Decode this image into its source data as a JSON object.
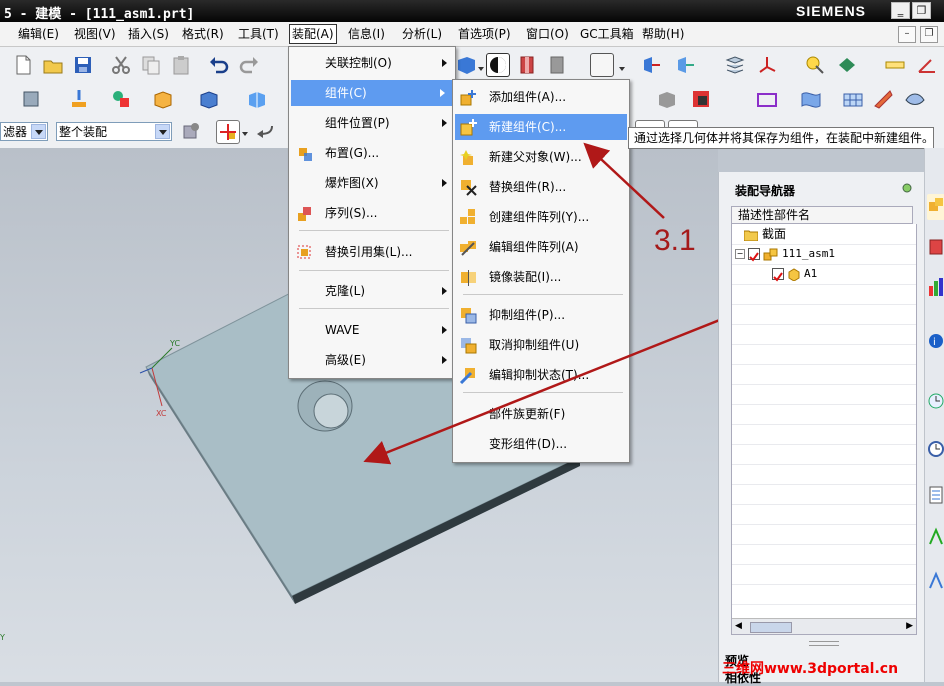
{
  "window": {
    "title": "5 - 建模 - [111_asm1.prt]",
    "brand": "SIEMENS",
    "controls": [
      "‗",
      "❐"
    ]
  },
  "menubar": {
    "items": [
      "编辑(E)",
      "视图(V)",
      "插入(S)",
      "格式(R)",
      "工具(T)",
      "装配(A)",
      "信息(I)",
      "分析(L)",
      "首选项(P)",
      "窗口(O)",
      "GC工具箱",
      "帮助(H)"
    ],
    "active_index": 5
  },
  "toolbar3": {
    "filter_label": "滤器",
    "scope_value": "整个装配"
  },
  "assembly_menu": {
    "items": [
      {
        "label": "关联控制(O)",
        "submenu": true
      },
      {
        "label": "组件(C)",
        "submenu": true,
        "highlighted": true
      },
      {
        "label": "组件位置(P)",
        "submenu": true
      },
      {
        "label": "布置(G)...",
        "submenu": false
      },
      {
        "label": "爆炸图(X)",
        "submenu": true
      },
      {
        "label": "序列(S)...",
        "submenu": false
      },
      {
        "label": "替换引用集(L)...",
        "submenu": false
      },
      {
        "label": "克隆(L)",
        "submenu": true
      },
      {
        "label": "WAVE",
        "submenu": true
      },
      {
        "label": "高级(E)",
        "submenu": true
      }
    ]
  },
  "component_menu": {
    "items": [
      {
        "label": "添加组件(A)..."
      },
      {
        "label": "新建组件(C)...",
        "highlighted": true
      },
      {
        "label": "新建父对象(W)..."
      },
      {
        "label": "替换组件(R)..."
      },
      {
        "label": "创建组件阵列(Y)..."
      },
      {
        "label": "编辑组件阵列(A)"
      },
      {
        "label": "镜像装配(I)..."
      },
      {
        "label": "抑制组件(P)..."
      },
      {
        "label": "取消抑制组件(U)"
      },
      {
        "label": "编辑抑制状态(T)..."
      },
      {
        "label": "部件族更新(F)"
      },
      {
        "label": "变形组件(D)..."
      }
    ]
  },
  "tooltip": "通过选择几何体并将其保存为组件，在装配中新建组件。",
  "annotation": "3.1",
  "navigator": {
    "title": "装配导航器",
    "column_header": "描述性部件名",
    "rows": [
      {
        "label": "截面",
        "icon": "folder-icon"
      },
      {
        "label": "111_asm1",
        "icon": "assembly-icon",
        "checked": true
      },
      {
        "label": "A1",
        "icon": "part-icon",
        "checked": true
      }
    ],
    "bottom_labels": [
      "预览",
      "相依性"
    ]
  },
  "viewport": {
    "triad": {
      "x": "XC",
      "y": "YC"
    }
  },
  "watermark": "三维网www.3dportal.cn",
  "colors": {
    "highlight": "#5e9bf0",
    "annotation_red": "#b01818",
    "part_face": "#a8bcc4"
  }
}
